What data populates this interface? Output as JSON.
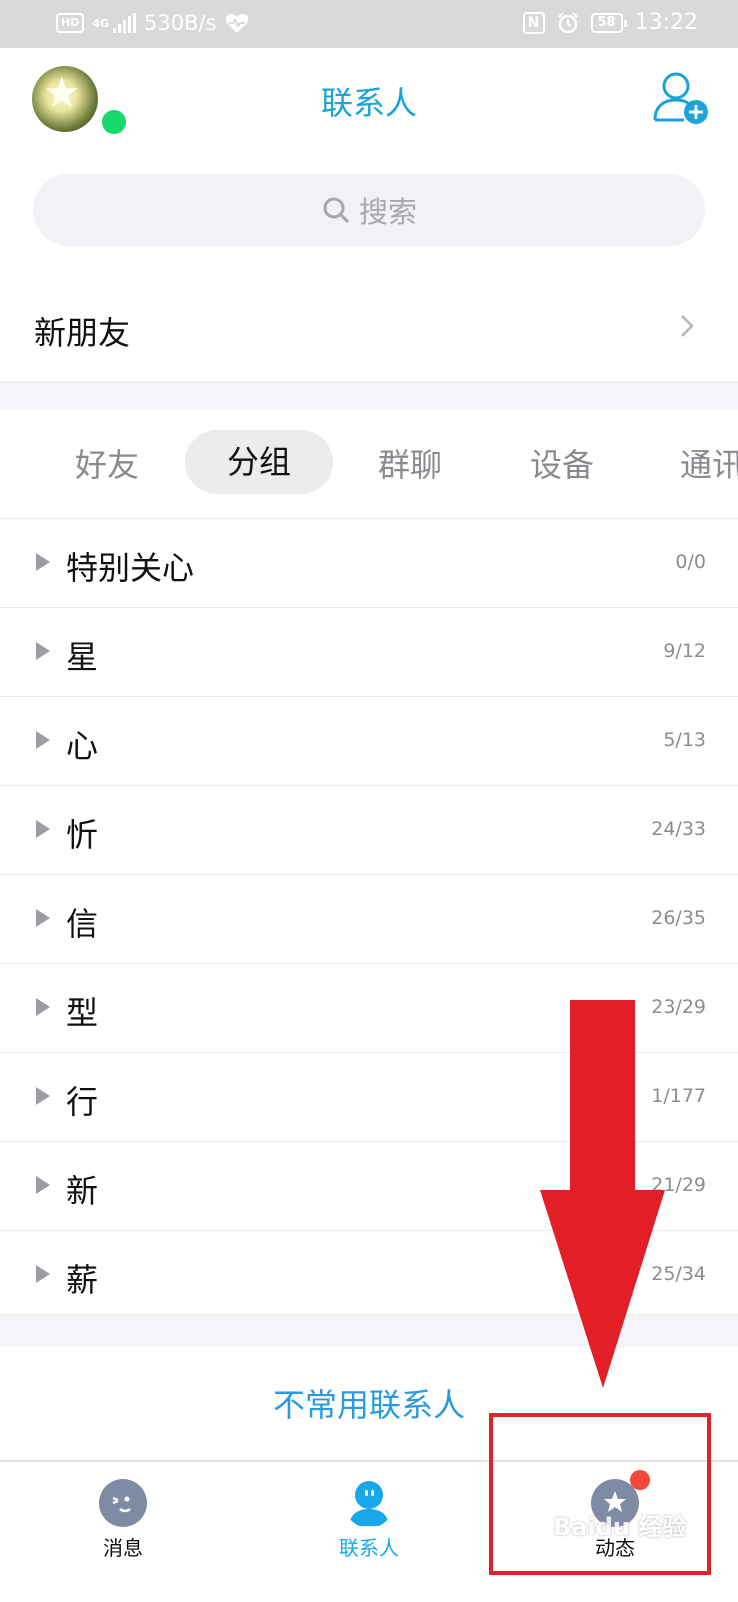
{
  "status_bar": {
    "hd": "HD",
    "network": "4G",
    "speed": "530B/s",
    "nfc": "N",
    "battery": "58",
    "time": "13:22"
  },
  "header": {
    "title": "联系人"
  },
  "search": {
    "placeholder": "搜索"
  },
  "new_friends": {
    "label": "新朋友"
  },
  "tabs": [
    "好友",
    "分组",
    "群聊",
    "设备",
    "通讯录"
  ],
  "active_tab": "分组",
  "groups": [
    {
      "name": "特别关心",
      "count": "0/0"
    },
    {
      "name": "星",
      "count": "9/12"
    },
    {
      "name": "心",
      "count": "5/13"
    },
    {
      "name": "忻",
      "count": "24/33"
    },
    {
      "name": "信",
      "count": "26/35"
    },
    {
      "name": "型",
      "count": "23/29"
    },
    {
      "name": "行",
      "count": "1/177"
    },
    {
      "name": "新",
      "count": "21/29"
    },
    {
      "name": "薪",
      "count": "25/34"
    }
  ],
  "uncommon_contacts": "不常用联系人",
  "bottom_nav": [
    {
      "label": "消息",
      "icon": "message-icon",
      "active": false
    },
    {
      "label": "联系人",
      "icon": "contacts-icon",
      "active": true
    },
    {
      "label": "动态",
      "icon": "feed-star-icon",
      "active": false,
      "badge": true
    }
  ],
  "watermark": "Baidu 经验",
  "colors": {
    "accent": "#1aa3d9",
    "link": "#2b9be0",
    "online": "#17d86b",
    "badge": "#f24a3a",
    "annotation": "#e0242c"
  }
}
